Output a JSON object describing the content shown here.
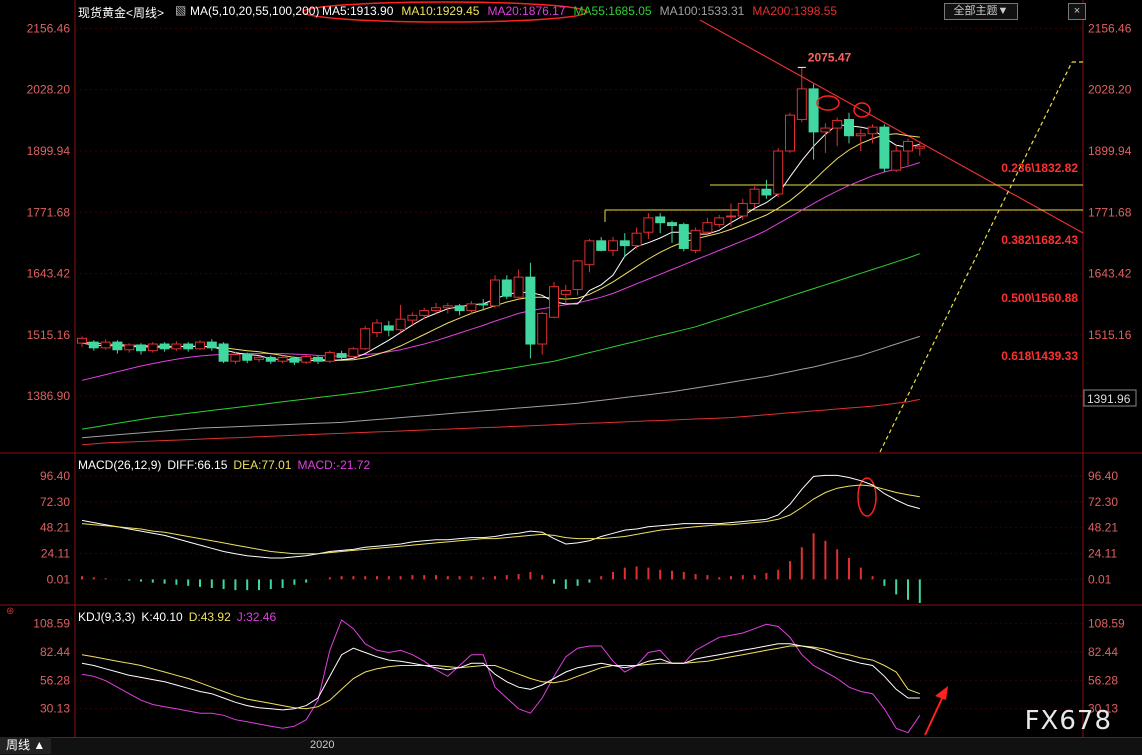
{
  "header": {
    "title": "现货黄金<周线>",
    "ma_params": "MA(5,10,20,55,100,200)",
    "ma_values": [
      {
        "label": "MA5:1913.90",
        "color": "#ffffff"
      },
      {
        "label": "MA10:1929.45",
        "color": "#f0e060"
      },
      {
        "label": "MA20:1876.17",
        "color": "#e040e0"
      },
      {
        "label": "MA55:1685.05",
        "color": "#30d030"
      },
      {
        "label": "MA100:1533.31",
        "color": "#a0a0a0"
      },
      {
        "label": "MA200:1398.55",
        "color": "#e03030"
      }
    ],
    "theme_button": "全部主题▼",
    "close_button": "×"
  },
  "colors": {
    "up": "#e03030",
    "down": "#40d8a0",
    "axis_text": "#e06060",
    "grid": "#3a0000"
  },
  "chart_data": [
    {
      "type": "candlestick",
      "panel": "price",
      "y_ticks": [
        "2156.46",
        "2028.20",
        "1899.94",
        "1771.68",
        "1643.42",
        "1515.16",
        "1386.90"
      ],
      "current_price": "1391.96",
      "peak_label": "2075.47",
      "fib_labels": [
        "0.236\\1832.82",
        "0.382\\1682.43",
        "0.500\\1560.88",
        "0.618\\1439.33"
      ],
      "ylim": [
        1270,
        2170
      ],
      "candles": [
        [
          1498,
          1508,
          1490,
          1512
        ],
        [
          1500,
          1488,
          1482,
          1504
        ],
        [
          1488,
          1500,
          1484,
          1506
        ],
        [
          1500,
          1484,
          1476,
          1504
        ],
        [
          1484,
          1494,
          1478,
          1498
        ],
        [
          1494,
          1482,
          1474,
          1498
        ],
        [
          1482,
          1496,
          1478,
          1500
        ],
        [
          1496,
          1486,
          1480,
          1500
        ],
        [
          1486,
          1496,
          1482,
          1502
        ],
        [
          1496,
          1486,
          1480,
          1500
        ],
        [
          1486,
          1500,
          1484,
          1504
        ],
        [
          1500,
          1488,
          1482,
          1506
        ],
        [
          1496,
          1460,
          1456,
          1500
        ],
        [
          1460,
          1474,
          1454,
          1480
        ],
        [
          1474,
          1462,
          1456,
          1478
        ],
        [
          1464,
          1468,
          1458,
          1472
        ],
        [
          1468,
          1460,
          1454,
          1472
        ],
        [
          1460,
          1468,
          1456,
          1472
        ],
        [
          1466,
          1458,
          1452,
          1470
        ],
        [
          1458,
          1470,
          1454,
          1474
        ],
        [
          1468,
          1460,
          1454,
          1472
        ],
        [
          1460,
          1478,
          1456,
          1482
        ],
        [
          1476,
          1468,
          1464,
          1482
        ],
        [
          1470,
          1486,
          1466,
          1490
        ],
        [
          1486,
          1528,
          1484,
          1534
        ],
        [
          1520,
          1540,
          1510,
          1548
        ],
        [
          1534,
          1525,
          1512,
          1544
        ],
        [
          1526,
          1548,
          1520,
          1578
        ],
        [
          1546,
          1556,
          1536,
          1562
        ],
        [
          1556,
          1566,
          1548,
          1572
        ],
        [
          1566,
          1572,
          1560,
          1582
        ],
        [
          1572,
          1576,
          1560,
          1582
        ],
        [
          1576,
          1566,
          1556,
          1580
        ],
        [
          1566,
          1580,
          1558,
          1586
        ],
        [
          1580,
          1578,
          1566,
          1590
        ],
        [
          1576,
          1630,
          1572,
          1640
        ],
        [
          1630,
          1596,
          1590,
          1640
        ],
        [
          1594,
          1636,
          1588,
          1652
        ],
        [
          1636,
          1496,
          1466,
          1666
        ],
        [
          1496,
          1560,
          1474,
          1564
        ],
        [
          1552,
          1616,
          1550,
          1626
        ],
        [
          1600,
          1608,
          1580,
          1620
        ],
        [
          1610,
          1670,
          1598,
          1672
        ],
        [
          1662,
          1712,
          1646,
          1716
        ],
        [
          1712,
          1692,
          1690,
          1720
        ],
        [
          1692,
          1712,
          1680,
          1720
        ],
        [
          1712,
          1702,
          1678,
          1728
        ],
        [
          1702,
          1728,
          1696,
          1740
        ],
        [
          1730,
          1760,
          1716,
          1770
        ],
        [
          1762,
          1750,
          1728,
          1770
        ],
        [
          1750,
          1744,
          1708,
          1754
        ],
        [
          1746,
          1696,
          1690,
          1750
        ],
        [
          1692,
          1734,
          1686,
          1740
        ],
        [
          1730,
          1750,
          1726,
          1760
        ],
        [
          1746,
          1760,
          1740,
          1766
        ],
        [
          1762,
          1764,
          1742,
          1790
        ],
        [
          1764,
          1790,
          1756,
          1800
        ],
        [
          1790,
          1820,
          1780,
          1826
        ],
        [
          1820,
          1808,
          1800,
          1840
        ],
        [
          1810,
          1900,
          1804,
          1906
        ],
        [
          1900,
          1975,
          1896,
          1980
        ],
        [
          1966,
          2030,
          1960,
          2075
        ],
        [
          2030,
          1940,
          1882,
          2040
        ],
        [
          1940,
          1948,
          1896,
          1958
        ],
        [
          1948,
          1964,
          1910,
          1970
        ],
        [
          1966,
          1932,
          1916,
          1980
        ],
        [
          1932,
          1936,
          1900,
          1946
        ],
        [
          1936,
          1950,
          1916,
          1956
        ],
        [
          1950,
          1864,
          1856,
          1956
        ],
        [
          1860,
          1900,
          1856,
          1912
        ],
        [
          1900,
          1920,
          1870,
          1926
        ],
        [
          1906,
          1910,
          1890,
          1920
        ]
      ],
      "ma5": [
        1498,
        1494,
        1492,
        1493,
        1491,
        1490,
        1490,
        1489,
        1490,
        1491,
        1491,
        1490,
        1484,
        1478,
        1474,
        1472,
        1465,
        1463,
        1463,
        1462,
        1461,
        1461,
        1463,
        1466,
        1476,
        1490,
        1504,
        1520,
        1536,
        1550,
        1560,
        1570,
        1574,
        1578,
        1580,
        1590,
        1600,
        1604,
        1604,
        1598,
        1584,
        1580,
        1580,
        1608,
        1620,
        1640,
        1680,
        1700,
        1708,
        1718,
        1730,
        1730,
        1726,
        1726,
        1734,
        1750,
        1764,
        1780,
        1792,
        1810,
        1846,
        1880,
        1910,
        1935,
        1955,
        1953,
        1950,
        1945,
        1928,
        1912,
        1908,
        1914
      ],
      "ma10": [
        1500,
        1498,
        1496,
        1495,
        1494,
        1493,
        1492,
        1491,
        1491,
        1491,
        1491,
        1490,
        1488,
        1485,
        1482,
        1480,
        1476,
        1472,
        1468,
        1466,
        1464,
        1462,
        1462,
        1463,
        1467,
        1474,
        1482,
        1492,
        1504,
        1516,
        1528,
        1540,
        1550,
        1560,
        1568,
        1576,
        1584,
        1590,
        1594,
        1594,
        1592,
        1590,
        1592,
        1600,
        1612,
        1626,
        1642,
        1658,
        1674,
        1688,
        1700,
        1710,
        1716,
        1722,
        1728,
        1736,
        1746,
        1756,
        1766,
        1780,
        1796,
        1816,
        1838,
        1862,
        1884,
        1902,
        1916,
        1926,
        1934,
        1936,
        1932,
        1929
      ],
      "ma20": [
        1420,
        1426,
        1432,
        1438,
        1444,
        1450,
        1455,
        1460,
        1464,
        1468,
        1471,
        1473,
        1474,
        1475,
        1476,
        1476,
        1476,
        1476,
        1475,
        1474,
        1472,
        1471,
        1471,
        1472,
        1474,
        1476,
        1480,
        1484,
        1490,
        1496,
        1503,
        1511,
        1519,
        1527,
        1535,
        1544,
        1552,
        1560,
        1566,
        1570,
        1574,
        1578,
        1582,
        1588,
        1594,
        1602,
        1612,
        1622,
        1632,
        1642,
        1652,
        1662,
        1672,
        1682,
        1692,
        1702,
        1712,
        1722,
        1734,
        1748,
        1762,
        1776,
        1790,
        1804,
        1816,
        1828,
        1838,
        1848,
        1856,
        1862,
        1868,
        1876
      ],
      "ma55": [
        1318,
        1322,
        1326,
        1330,
        1334,
        1338,
        1342,
        1345,
        1348,
        1351,
        1354,
        1357,
        1360,
        1363,
        1366,
        1369,
        1372,
        1375,
        1378,
        1381,
        1384,
        1387,
        1390,
        1393,
        1396,
        1400,
        1404,
        1408,
        1412,
        1416,
        1420,
        1424,
        1428,
        1432,
        1436,
        1440,
        1444,
        1448,
        1452,
        1456,
        1460,
        1466,
        1472,
        1478,
        1484,
        1490,
        1496,
        1502,
        1508,
        1514,
        1520,
        1526,
        1532,
        1540,
        1548,
        1556,
        1564,
        1572,
        1580,
        1588,
        1596,
        1604,
        1612,
        1620,
        1628,
        1636,
        1644,
        1652,
        1660,
        1668,
        1676,
        1685
      ],
      "ma100": [
        1300,
        1302,
        1304,
        1306,
        1308,
        1310,
        1312,
        1314,
        1316,
        1318,
        1320,
        1321,
        1322,
        1323,
        1324,
        1325,
        1326,
        1327,
        1328,
        1329,
        1330,
        1331,
        1332,
        1334,
        1336,
        1338,
        1340,
        1342,
        1344,
        1346,
        1348,
        1350,
        1352,
        1354,
        1356,
        1358,
        1360,
        1362,
        1364,
        1366,
        1368,
        1370,
        1372,
        1375,
        1378,
        1381,
        1384,
        1387,
        1390,
        1393,
        1396,
        1400,
        1404,
        1408,
        1412,
        1416,
        1420,
        1424,
        1428,
        1433,
        1438,
        1443,
        1448,
        1454,
        1460,
        1466,
        1472,
        1480,
        1488,
        1496,
        1504,
        1512
      ],
      "ma200": [
        1285,
        1287,
        1289,
        1290,
        1291,
        1292,
        1293,
        1294,
        1295,
        1296,
        1297,
        1298,
        1299,
        1300,
        1301,
        1302,
        1303,
        1304,
        1305,
        1306,
        1307,
        1308,
        1309,
        1310,
        1311,
        1312,
        1313,
        1314,
        1315,
        1316,
        1317,
        1318,
        1319,
        1320,
        1321,
        1322,
        1323,
        1324,
        1325,
        1326,
        1327,
        1328,
        1329,
        1330,
        1331,
        1332,
        1333,
        1334,
        1335,
        1336,
        1337,
        1338,
        1339,
        1340,
        1341,
        1342,
        1344,
        1346,
        1348,
        1350,
        1352,
        1354,
        1356,
        1358,
        1360,
        1362,
        1364,
        1366,
        1369,
        1372,
        1375,
        1380
      ]
    },
    {
      "type": "line",
      "panel": "macd",
      "title": "MACD(26,12,9)",
      "legend": [
        {
          "label": "DIFF:66.15",
          "color": "#ffffff"
        },
        {
          "label": "DEA:77.01",
          "color": "#f0e060"
        },
        {
          "label": "MACD:-21.72",
          "color": "#e040e0"
        }
      ],
      "y_ticks": [
        "96.40",
        "72.30",
        "48.21",
        "24.11",
        "0.01"
      ],
      "ylim": [
        -22,
        102
      ],
      "diff": [
        55,
        53,
        51,
        49,
        47,
        45,
        43,
        41,
        38,
        35,
        32,
        29,
        26,
        24,
        22,
        21,
        20,
        20,
        21,
        22,
        24,
        26,
        27,
        28,
        30,
        31,
        32,
        33,
        35,
        36,
        37,
        37,
        38,
        39,
        39,
        40,
        42,
        43,
        45,
        44,
        38,
        33,
        34,
        36,
        40,
        43,
        46,
        47,
        49,
        50,
        51,
        52,
        52,
        52,
        52,
        53,
        54,
        55,
        56,
        60,
        70,
        84,
        96,
        97,
        97,
        95,
        92,
        88,
        80,
        74,
        69,
        66
      ],
      "dea": [
        52,
        51,
        50,
        49,
        48,
        47,
        45,
        44,
        42,
        40,
        38,
        36,
        34,
        32,
        30,
        28,
        26,
        25,
        24,
        24,
        24,
        25,
        26,
        27,
        28,
        29,
        30,
        31,
        32,
        33,
        34,
        35,
        36,
        37,
        38,
        38,
        39,
        40,
        41,
        42,
        41,
        39,
        38,
        38,
        38,
        39,
        40,
        42,
        44,
        46,
        47,
        48,
        49,
        50,
        51,
        51,
        52,
        53,
        54,
        56,
        60,
        67,
        75,
        81,
        85,
        87,
        88,
        87,
        84,
        81,
        79,
        77
      ],
      "macd": [
        3,
        2,
        1,
        0,
        -1,
        -2,
        -3,
        -4,
        -5,
        -6,
        -7,
        -8,
        -9,
        -10,
        -10,
        -10,
        -9,
        -8,
        -5,
        -3,
        0,
        2,
        3,
        3,
        3,
        3,
        3,
        3,
        4,
        4,
        4,
        3,
        3,
        3,
        2,
        3,
        4,
        5,
        7,
        4,
        -4,
        -9,
        -6,
        -3,
        3,
        7,
        11,
        12,
        11,
        9,
        8,
        7,
        5,
        4,
        2,
        3,
        4,
        4,
        6,
        9,
        17,
        30,
        43,
        36,
        28,
        20,
        11,
        3,
        -6,
        -14,
        -19,
        -22
      ]
    },
    {
      "type": "line",
      "panel": "kdj",
      "title": "KDJ(9,3,3)",
      "legend": [
        {
          "label": "K:40.10",
          "color": "#ffffff"
        },
        {
          "label": "D:43.92",
          "color": "#f0e060"
        },
        {
          "label": "J:32.46",
          "color": "#e040e0"
        }
      ],
      "y_ticks": [
        "108.59",
        "82.44",
        "56.28",
        "30.13"
      ],
      "ylim": [
        4,
        112
      ],
      "k": [
        72,
        70,
        67,
        64,
        61,
        59,
        57,
        55,
        52,
        49,
        46,
        44,
        40,
        36,
        33,
        31,
        30,
        29,
        30,
        33,
        40,
        60,
        80,
        86,
        82,
        78,
        75,
        74,
        72,
        70,
        68,
        66,
        68,
        72,
        72,
        62,
        55,
        50,
        48,
        52,
        58,
        64,
        68,
        70,
        72,
        70,
        68,
        70,
        74,
        76,
        72,
        72,
        76,
        78,
        80,
        82,
        84,
        86,
        88,
        90,
        90,
        88,
        86,
        82,
        78,
        75,
        72,
        70,
        60,
        48,
        40,
        40
      ],
      "d": [
        80,
        78,
        76,
        74,
        72,
        70,
        67,
        64,
        61,
        58,
        54,
        50,
        46,
        42,
        39,
        37,
        35,
        33,
        31,
        30,
        32,
        38,
        48,
        58,
        64,
        67,
        69,
        70,
        70,
        70,
        70,
        69,
        68,
        69,
        70,
        70,
        66,
        62,
        58,
        55,
        54,
        56,
        60,
        64,
        68,
        70,
        70,
        70,
        71,
        72,
        72,
        72,
        73,
        74,
        76,
        78,
        80,
        82,
        84,
        86,
        88,
        88,
        87,
        85,
        82,
        80,
        77,
        75,
        70,
        64,
        48,
        44
      ],
      "j": [
        62,
        60,
        56,
        50,
        44,
        38,
        34,
        32,
        30,
        28,
        26,
        26,
        24,
        20,
        18,
        16,
        14,
        12,
        14,
        20,
        38,
        84,
        112,
        104,
        90,
        84,
        82,
        84,
        80,
        74,
        66,
        60,
        70,
        80,
        80,
        50,
        40,
        30,
        26,
        40,
        60,
        78,
        86,
        88,
        88,
        74,
        64,
        70,
        82,
        84,
        72,
        72,
        84,
        90,
        96,
        98,
        100,
        104,
        108,
        106,
        96,
        80,
        70,
        64,
        58,
        50,
        46,
        44,
        30,
        12,
        8,
        24
      ]
    }
  ],
  "bottom": {
    "period_tab": "周线 ▲",
    "year_label": "2020"
  },
  "watermark": "FX678"
}
